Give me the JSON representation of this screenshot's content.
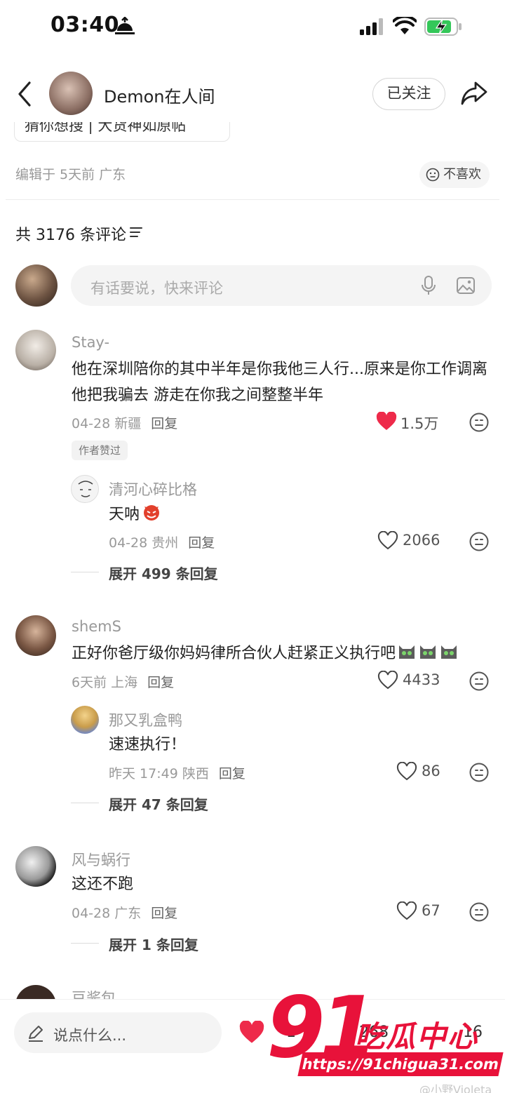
{
  "status": {
    "time": "03:40"
  },
  "header": {
    "author_name": "Demon在人间",
    "follow_label": "已关注"
  },
  "post": {
    "search_chip": "猜你想搜 | 大货神如原帖",
    "edit_meta": "编辑于 5天前 广东",
    "dislike_label": "不喜欢"
  },
  "comments_header": {
    "count_text": "共 3176 条评论"
  },
  "comment_input": {
    "placeholder": "有话要说，快来评论"
  },
  "comments": [
    {
      "user": "Stay-",
      "text": "他在深圳陪你的其中半年是你我他三人行...原来是你工作调离 他把我骗去 游走在你我之间整整半年",
      "meta": "04-28 新疆",
      "reply": "回复",
      "likes": "1.5万",
      "liked": true,
      "badge": "作者赞过",
      "replies": [
        {
          "user": "清河心碎比格",
          "text": "天呐",
          "meta": "04-28 贵州",
          "reply": "回复",
          "likes": "2066"
        }
      ],
      "expand": "展开 499 条回复"
    },
    {
      "user": "shemS",
      "text": "正好你爸厅级你妈妈律所合伙人赶紧正义执行吧",
      "meta": "6天前 上海",
      "reply": "回复",
      "likes": "4433",
      "replies": [
        {
          "user": "那又乳盒鸭",
          "text": "速速执行！",
          "meta": "昨天 17:49 陕西",
          "reply": "回复",
          "likes": "86"
        }
      ],
      "expand": "展开 47 条回复"
    },
    {
      "user": "风与蜗行",
      "text": "这还不跑",
      "meta": "04-28 广东",
      "reply": "回复",
      "likes": "67",
      "expand": "展开 1 条回复"
    },
    {
      "user": "豆酱包"
    }
  ],
  "bottom_bar": {
    "say_placeholder": "说点什么...",
    "stat_likes": "1",
    "stat_collects": "268",
    "stat_comments": "16"
  },
  "watermark": {
    "number": "91",
    "brand": "吃瓜中心",
    "url": "https://91chigua31.com",
    "handle": "@小野Violeta"
  },
  "colors": {
    "like_red": "#ee2a4a",
    "watermark_red": "#e8123a"
  }
}
